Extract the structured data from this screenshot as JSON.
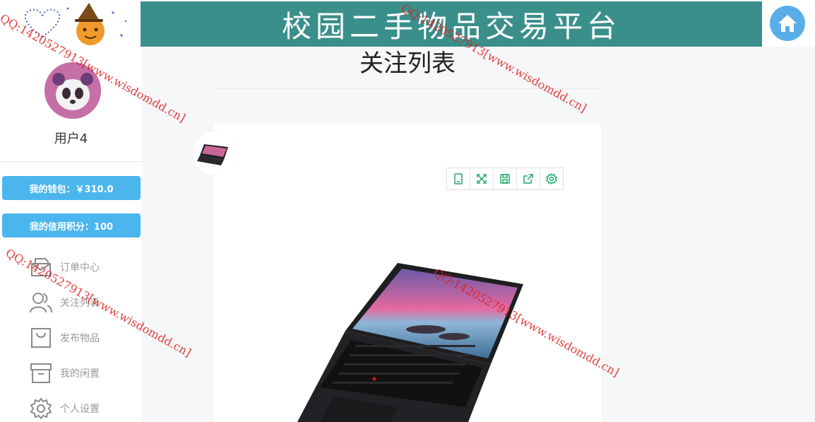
{
  "header": {
    "banner_title": "校园二手物品交易平台"
  },
  "user": {
    "name": "用户4",
    "wallet": "我的钱包：￥310.0",
    "credit": "我的信用积分：100"
  },
  "menu": [
    {
      "label": "订单中心",
      "icon": "mail-icon"
    },
    {
      "label": "关注列表",
      "icon": "users-icon"
    },
    {
      "label": "发布物品",
      "icon": "bag-icon"
    },
    {
      "label": "我的闲置",
      "icon": "archive-icon"
    },
    {
      "label": "个人设置",
      "icon": "gear-icon"
    }
  ],
  "main": {
    "title": "关注列表"
  },
  "toolbar_icons": [
    "mobile-icon",
    "expand-icon",
    "save-icon",
    "share-icon",
    "settings-icon"
  ],
  "watermark": "QQ:1420527913[www.wisdomdd.cn]",
  "colors": {
    "banner": "#3a8f8b",
    "button": "#4bb6ee",
    "home": "#5aaee8",
    "tool_icon": "#22a86a"
  }
}
